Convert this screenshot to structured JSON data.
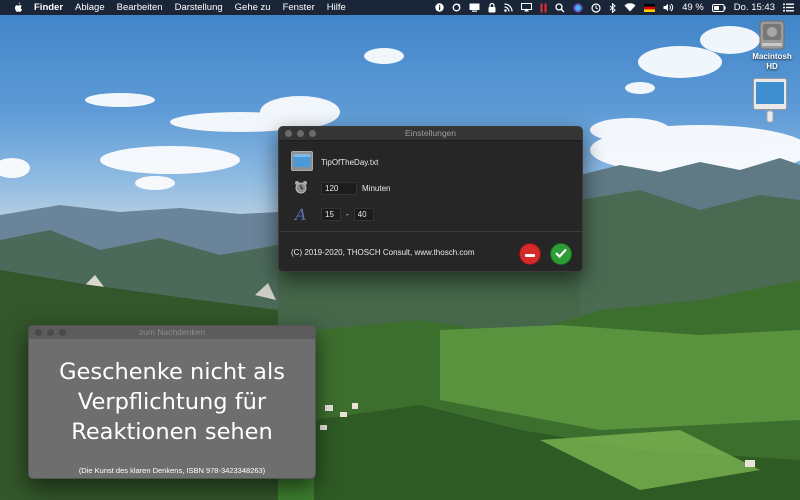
{
  "menubar": {
    "app_name": "Finder",
    "items": [
      "Ablage",
      "Bearbeiten",
      "Darstellung",
      "Gehe zu",
      "Fenster",
      "Hilfe"
    ],
    "status": {
      "battery_text": "49 %",
      "clock": "Do. 15:43",
      "icons": [
        "info-icon",
        "sync-icon",
        "display-icon",
        "lock-icon",
        "rss-icon",
        "cast-icon",
        "pause-icon",
        "search-icon",
        "siri-icon",
        "time-machine-icon",
        "bluetooth-icon",
        "wifi-icon",
        "flag-de-icon",
        "volume-icon",
        "battery-icon",
        "menu-list-icon"
      ]
    }
  },
  "desktop": {
    "icons": [
      {
        "label": "Macintosh HD",
        "icon": "hard-drive-icon"
      },
      {
        "label": "",
        "icon": "usb-drive-icon"
      }
    ]
  },
  "settings_window": {
    "title": "Einstellungen",
    "file_name": "TipOfTheDay.txt",
    "interval_value": "120",
    "interval_unit": "Minuten",
    "font_min": "15",
    "range_separator": "-",
    "font_max": "40",
    "copyright": "(C) 2019-2020, THOSCH Consult, www.thosch.com"
  },
  "nachdenken_window": {
    "title": "zum Nachdenken",
    "quote_lines": [
      "Geschenke nicht als",
      "Verpflichtung für",
      "Reaktionen sehen"
    ],
    "source": "(Die Kunst des klaren Denkens, ISBN 978-3423348263)"
  }
}
